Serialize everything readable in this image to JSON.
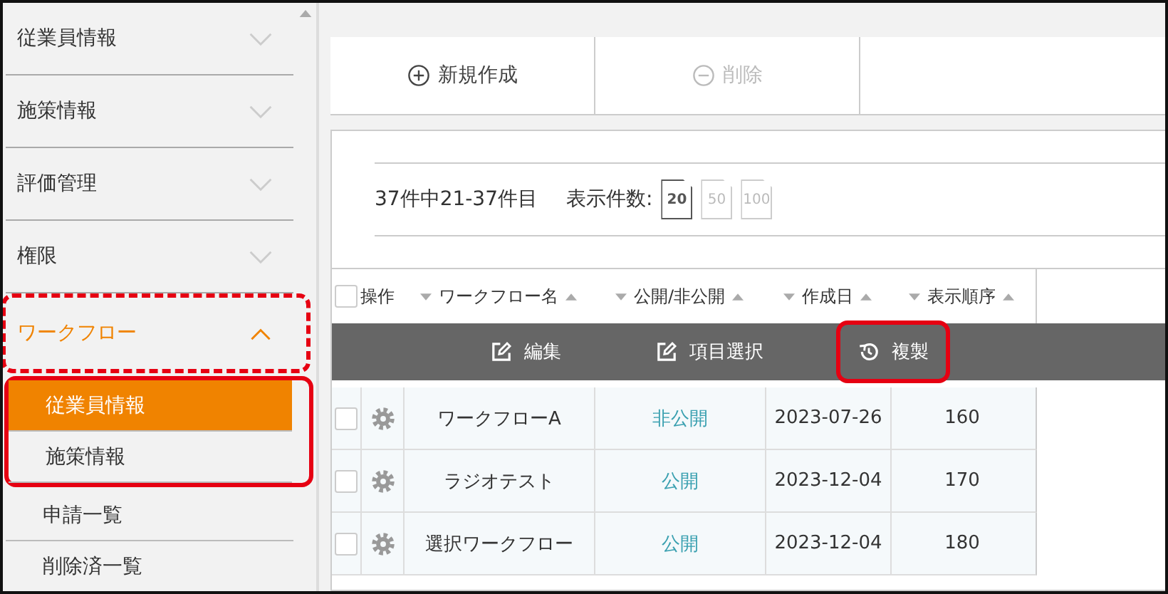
{
  "sidebar": {
    "items": [
      {
        "label": "従業員情報",
        "expanded": false
      },
      {
        "label": "施策情報",
        "expanded": false
      },
      {
        "label": "評価管理",
        "expanded": false
      },
      {
        "label": "権限",
        "expanded": false
      },
      {
        "label": "ワークフロー",
        "expanded": true,
        "highlight": true,
        "children": [
          {
            "label": "従業員情報",
            "selected": true,
            "highlight": true
          },
          {
            "label": "施策情報",
            "selected": false,
            "highlight": true
          },
          {
            "label": "申請一覧",
            "selected": false,
            "highlight": false
          },
          {
            "label": "削除済一覧",
            "selected": false,
            "highlight": false
          }
        ]
      }
    ]
  },
  "toolbar": [
    {
      "label": "新規作成",
      "kind": "add",
      "disabled": false
    },
    {
      "label": "削除",
      "kind": "remove",
      "disabled": true
    }
  ],
  "pagination": {
    "summary": "37件中21-37件目",
    "page_size_label": "表示件数:",
    "page_sizes": [
      {
        "label": "20",
        "selected": true
      },
      {
        "label": "50",
        "selected": false
      },
      {
        "label": "100",
        "selected": false
      }
    ]
  },
  "table": {
    "all_checked": false,
    "columns": [
      "操作",
      "ワークフロー名",
      "公開/非公開",
      "作成日",
      "表示順序"
    ],
    "row_actions": [
      {
        "label": "編集",
        "kind": "edit",
        "highlight": false
      },
      {
        "label": "項目選択",
        "kind": "edit",
        "highlight": false
      },
      {
        "label": "複製",
        "kind": "history",
        "highlight": true
      }
    ],
    "rows": [
      {
        "checked": false,
        "name": "ワークフローA",
        "status": "非公開",
        "created": "2023-07-26",
        "order": "160"
      },
      {
        "checked": false,
        "name": "ラジオテスト",
        "status": "公開",
        "created": "2023-12-04",
        "order": "170"
      },
      {
        "checked": false,
        "name": "選択ワークフロー",
        "status": "公開",
        "created": "2023-12-04",
        "order": "180"
      }
    ]
  }
}
